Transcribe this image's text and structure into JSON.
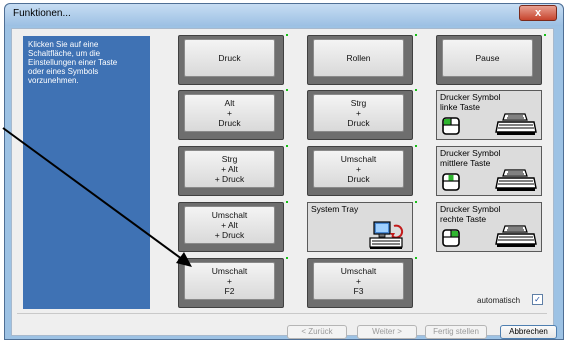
{
  "window": {
    "title": "Funktionen...",
    "close_label": "x"
  },
  "info_text": "Klicken Sie auf eine\nSchaltfläche, um die\nEinstellungen einer Taste\noder eines Symbols\nvorzunehmen.",
  "keys": {
    "druck": "Druck",
    "rollen": "Rollen",
    "pause": "Pause",
    "alt_druck": "Alt\n+\nDruck",
    "strg_druck": "Strg\n+\nDruck",
    "strg_alt_druck": "Strg\n+ Alt\n+ Druck",
    "umschalt_druck": "Umschalt\n+\nDruck",
    "umschalt_alt_druck": "Umschalt\n+ Alt\n+ Druck",
    "umschalt_f2": "Umschalt\n+\nF2",
    "umschalt_f3": "Umschalt\n+\nF3"
  },
  "symbols": {
    "left": "Drucker Symbol\nlinke Taste",
    "middle": "Drucker Symbol\nmittlere Taste",
    "right": "Drucker Symbol\nrechte Taste",
    "tray": "System Tray"
  },
  "auto_label": "automatisch",
  "auto_checked": "✓",
  "buttons": {
    "back": "< Zurück",
    "next": "Weiter >",
    "finish": "Fertig stellen",
    "cancel": "Abbrechen"
  }
}
